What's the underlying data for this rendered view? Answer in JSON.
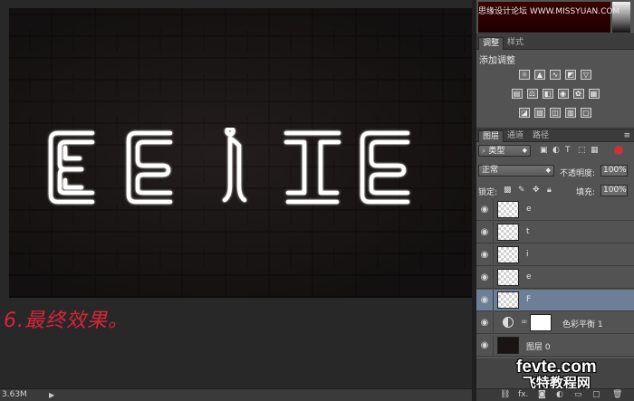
{
  "document": {
    "artwork_text": [
      "E",
      "E",
      "i",
      "t",
      "E"
    ],
    "caption": "6.最终效果。"
  },
  "status_bar": {
    "zoom": "3.63M",
    "arrow": "▶"
  },
  "color_panel": {
    "watermark": "思缘设计论坛 WWW.MISSYUAN.COM"
  },
  "adjust_panel": {
    "tabs": [
      "调整",
      "样式"
    ],
    "add_label": "添加调整",
    "icon_rows": [
      [
        "brightness-icon",
        "levels-icon",
        "curves-icon",
        "exposure-icon",
        "vibrance-icon"
      ],
      [
        "hue-sat-icon",
        "color-balance-icon",
        "black-white-icon",
        "photo-filter-icon",
        "channel-mixer-icon",
        "color-lookup-icon"
      ],
      [
        "invert-icon",
        "posterize-icon",
        "threshold-icon",
        "gradient-map-icon",
        "selective-color-icon"
      ]
    ]
  },
  "layers_panel": {
    "tabs": [
      "图层",
      "通道",
      "路径"
    ],
    "filter_select": "类型",
    "blend_mode": "正常",
    "opacity_label": "不透明度:",
    "opacity_value": "100%",
    "lock_label": "锁定:",
    "fill_label": "填充:",
    "fill_value": "100%",
    "layers": [
      {
        "name": "e",
        "selected": false,
        "kind": "text"
      },
      {
        "name": "t",
        "selected": false,
        "kind": "text"
      },
      {
        "name": "i",
        "selected": false,
        "kind": "text"
      },
      {
        "name": "e",
        "selected": false,
        "kind": "text"
      },
      {
        "name": "F",
        "selected": true,
        "kind": "text"
      },
      {
        "name": "色彩平衡 1",
        "selected": false,
        "kind": "adjustment"
      },
      {
        "name": "图层 0",
        "selected": false,
        "kind": "background"
      }
    ]
  },
  "footer": {
    "icons": [
      "link-icon",
      "fx-icon",
      "mask-icon",
      "adjustment-icon",
      "folder-icon",
      "new-layer-icon",
      "trash-icon"
    ],
    "fx_label": "fx.",
    "watermark_en": "fevte.com",
    "watermark_cn": "飞特教程网"
  },
  "colors": {
    "caption": "#d8253a",
    "selected_layer": "#6d7f96",
    "panel_bg": "#535353"
  }
}
